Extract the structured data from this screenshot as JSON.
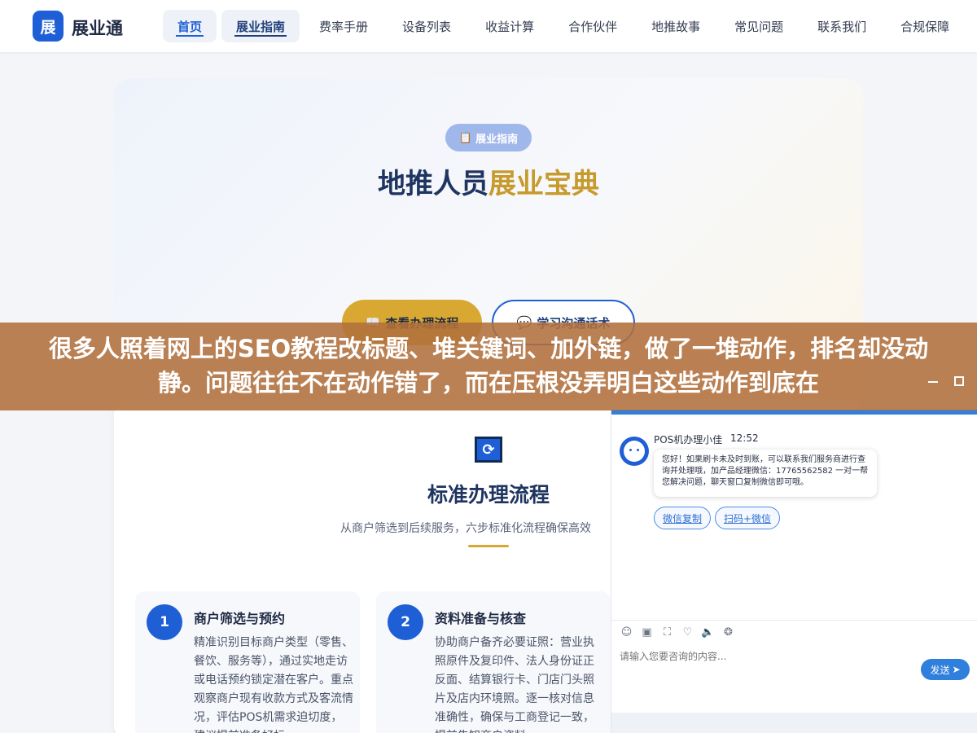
{
  "brand": {
    "logo_char": "展",
    "name": "展业通"
  },
  "nav": [
    {
      "label": "首页"
    },
    {
      "label": "展业指南"
    },
    {
      "label": "费率手册"
    },
    {
      "label": "设备列表"
    },
    {
      "label": "收益计算"
    },
    {
      "label": "合作伙伴"
    },
    {
      "label": "地推故事"
    },
    {
      "label": "常见问题"
    },
    {
      "label": "联系我们"
    },
    {
      "label": "合规保障"
    }
  ],
  "hero": {
    "badge": "展业指南",
    "title_part1": "地推人员",
    "title_part2": "展业宝典",
    "btn_primary": "查看办理流程",
    "btn_secondary": "学习沟通话术"
  },
  "banner": {
    "text": "很多人照着网上的SEO教程改标题、堆关键词、加外链，做了一堆动作，排名却没动静。问题往往不在动作错了，而在压根没弄明白这些动作到底在"
  },
  "section": {
    "title": "标准办理流程",
    "subtitle": "从商户筛选到后续服务，六步标准化流程确保高效",
    "steps": [
      {
        "num": "1",
        "title": "商户筛选与预约",
        "body": "精准识别目标商户类型（零售、餐饮、服务等），通过实地走访或电话预约锁定潜在客户。重点观察商户现有收款方式及客流情况，评估POS机需求迫切度，建议提前准备好标"
      },
      {
        "num": "2",
        "title": "资料准备与核查",
        "body": "协助商户备齐必要证照：营业执照原件及复印件、法人身份证正反面、结算银行卡、门店门头照片及店内环境照。逐一核对信息准确性，确保与工商登记一致，提前告知商户资料"
      }
    ]
  },
  "chat": {
    "agent": "POS机办理小佳",
    "time": "12:52",
    "message": "您好！如果刷卡未及时到账，可以联系我们服务商进行查询并处理哦，加产品经理微信：17765562582 一对一帮您解决问题，聊天窗口复制微信即可哦。",
    "chip_copy": "微信复制",
    "chip_scan": "扫码+微信",
    "input_placeholder": "请输入您要咨询的内容...",
    "send_label": "发送"
  },
  "colors": {
    "primary": "#1f5fd6",
    "gold": "#d8a833",
    "banner": "#b0703c"
  }
}
